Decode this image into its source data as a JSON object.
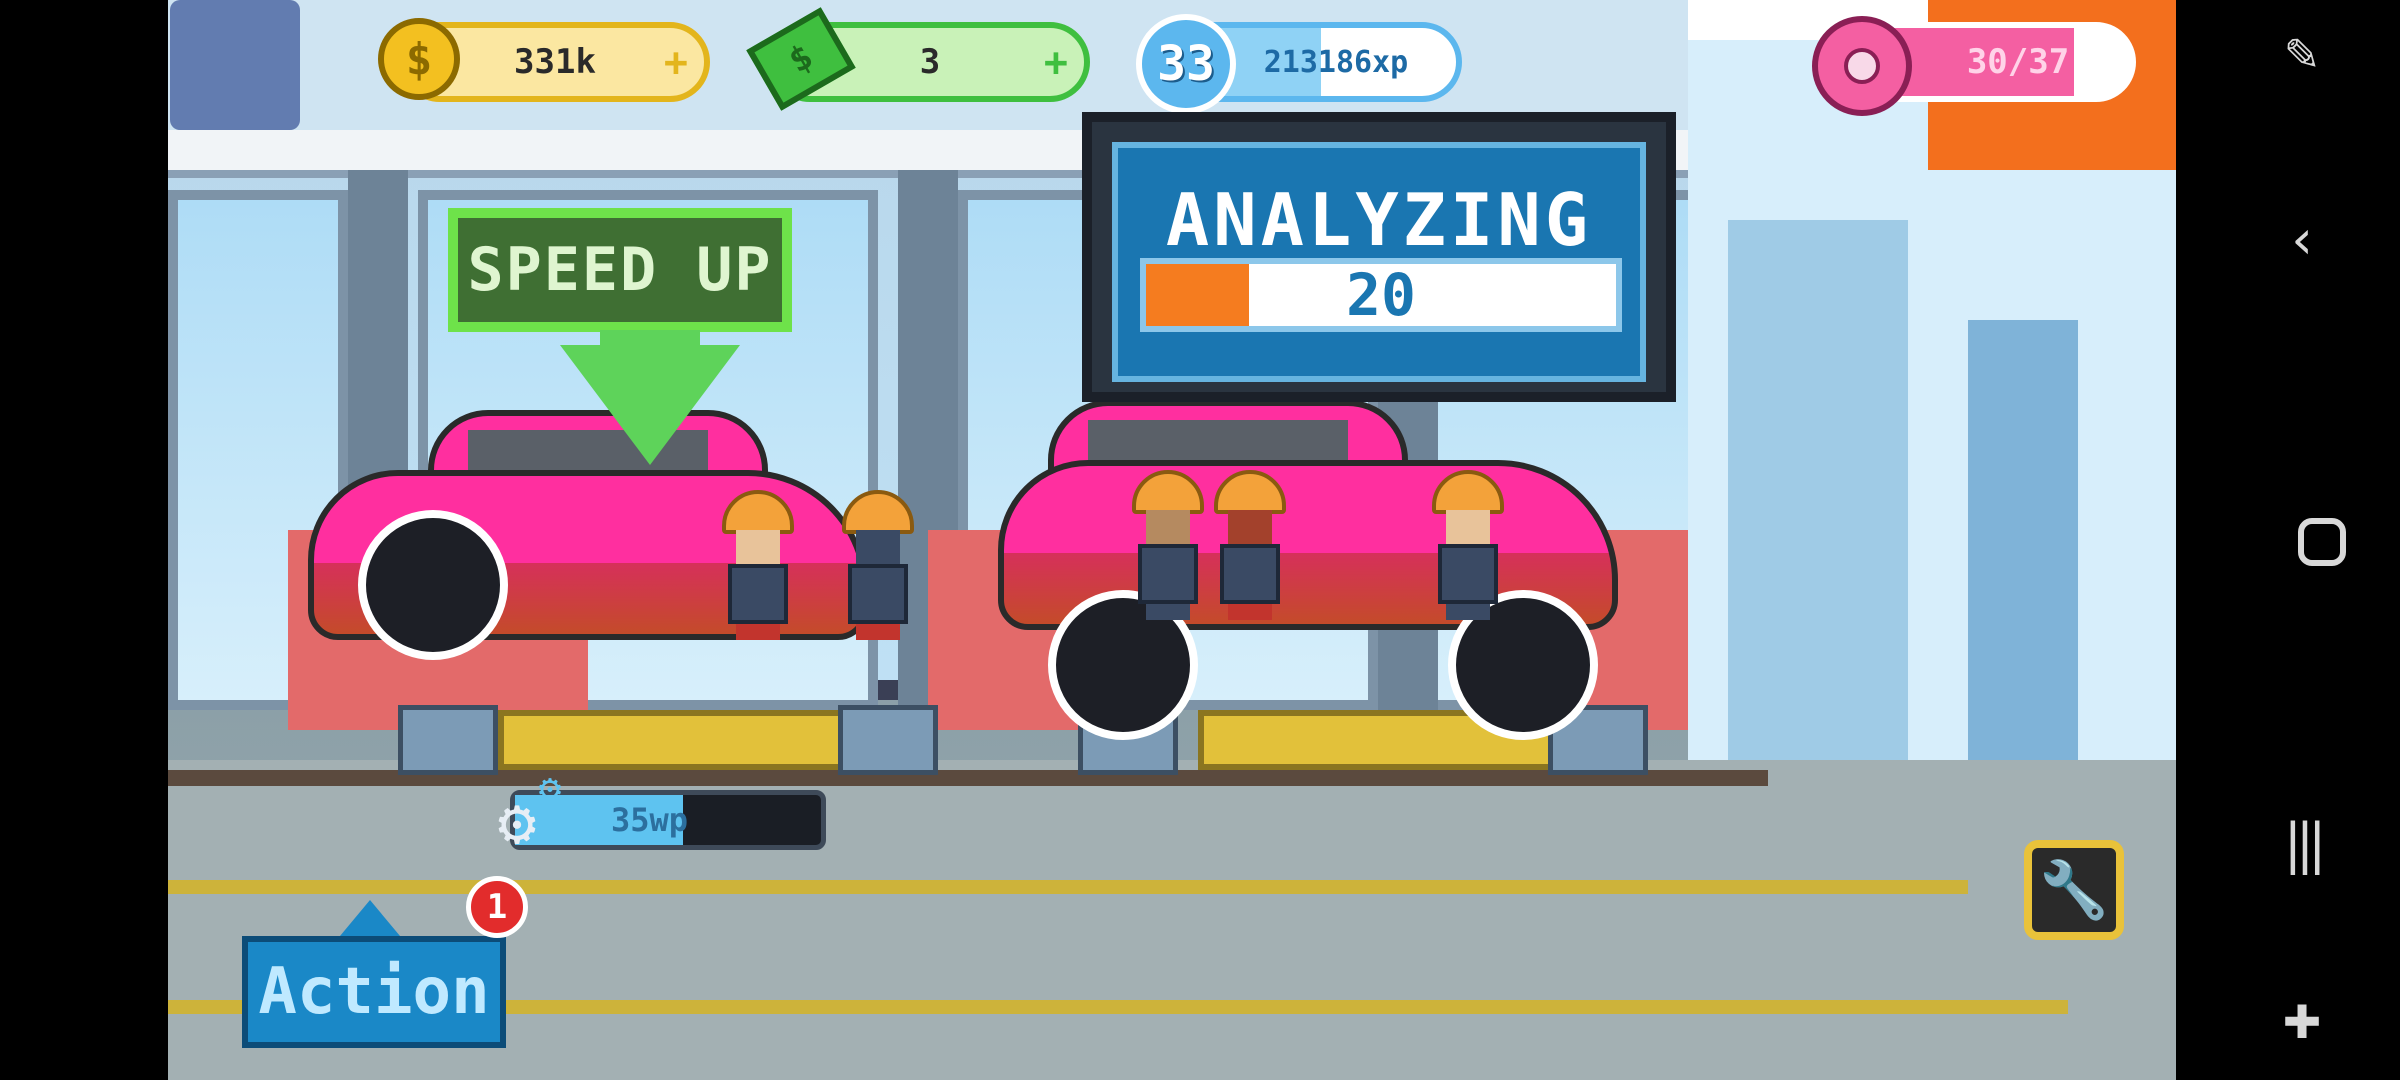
{
  "hud": {
    "coins": "331k",
    "cash": "3",
    "level": "33",
    "xp": "213186xp",
    "xp_progress": 0.55,
    "donuts": "30/37",
    "donut_progress": 0.81
  },
  "speed_up_label": "SPEED UP",
  "analyzing": {
    "title": "ANALYZING",
    "value": "20",
    "progress": 0.22
  },
  "workpoints": {
    "label": "35wp",
    "progress": 0.55
  },
  "action": {
    "label": "Action",
    "badge_count": "1"
  },
  "icons": [
    "coin-icon",
    "cash-icon",
    "level-icon",
    "donut-icon",
    "gear-icon",
    "wrench-icon",
    "back-icon",
    "home-icon",
    "recents-icon",
    "game-tools-icon",
    "screenshot-tool-icon"
  ],
  "colors": {
    "accent_green": "#6ee24a",
    "analyze_blue": "#1a76b1",
    "analyze_orange": "#f57c1f",
    "car_pink": "#ff2f9f",
    "action_blue": "#1a88c7",
    "badge_red": "#e22c2c"
  }
}
